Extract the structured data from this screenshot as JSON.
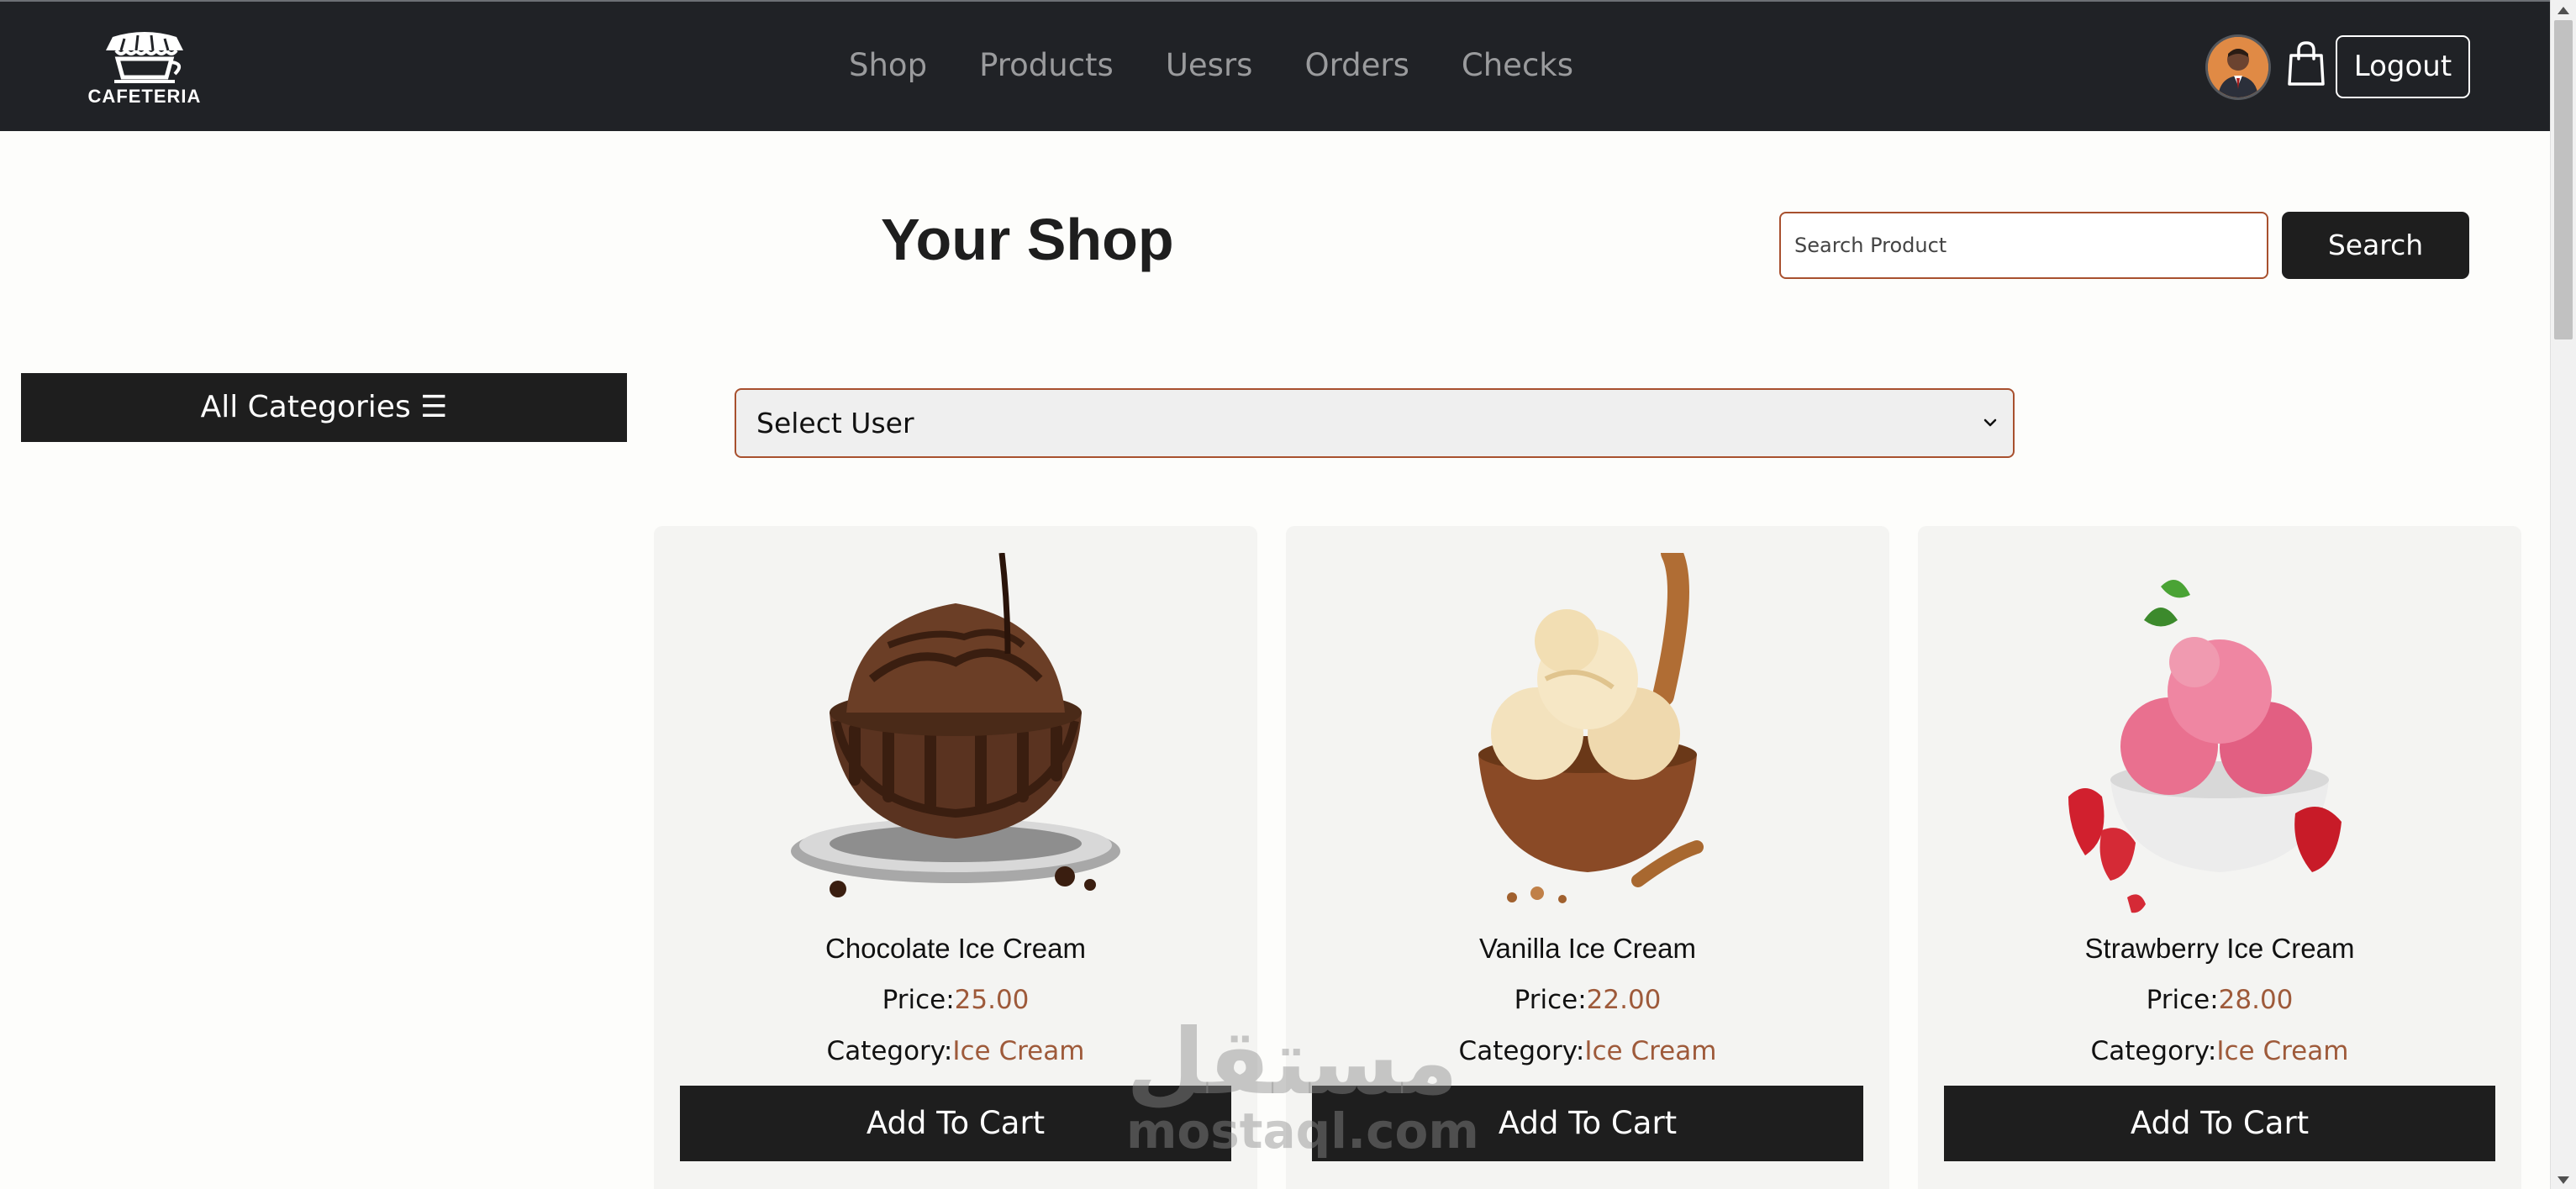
{
  "brand": {
    "name": "CAFETERIA",
    "logo_icon": "cafe-awning-cup-icon"
  },
  "nav": {
    "links": [
      {
        "label": "Shop"
      },
      {
        "label": "Products"
      },
      {
        "label": "Uesrs"
      },
      {
        "label": "Orders"
      },
      {
        "label": "Checks"
      }
    ],
    "avatar_icon": "user-avatar",
    "cart_icon": "shopping-bag-icon",
    "logout_label": "Logout"
  },
  "page": {
    "title": "Your Shop",
    "search_placeholder": "Search Product",
    "search_value": "",
    "search_button": "Search"
  },
  "sidebar": {
    "categories_button": "All Categories ☰"
  },
  "user_select": {
    "selected": "Select User"
  },
  "products": [
    {
      "name": "Chocolate Ice Cream",
      "price_label": "Price:",
      "price": "25.00",
      "category_label": "Category:",
      "category": "Ice Cream",
      "button": "Add To Cart",
      "image_icon": "chocolate-ice-cream-image"
    },
    {
      "name": "Vanilla Ice Cream",
      "price_label": "Price:",
      "price": "22.00",
      "category_label": "Category:",
      "category": "Ice Cream",
      "button": "Add To Cart",
      "image_icon": "vanilla-ice-cream-image"
    },
    {
      "name": "Strawberry Ice Cream",
      "price_label": "Price:",
      "price": "28.00",
      "category_label": "Category:",
      "category": "Ice Cream",
      "button": "Add To Cart",
      "image_icon": "strawberry-ice-cream-image"
    }
  ],
  "watermark": {
    "arabic": "مستقل",
    "latin": "mostaql.com"
  },
  "colors": {
    "navbar": "#202226",
    "accent": "#9e5a3a",
    "button_dark": "#1e1e1e",
    "card_bg": "#f4f4f2",
    "input_border": "#a8502e"
  }
}
